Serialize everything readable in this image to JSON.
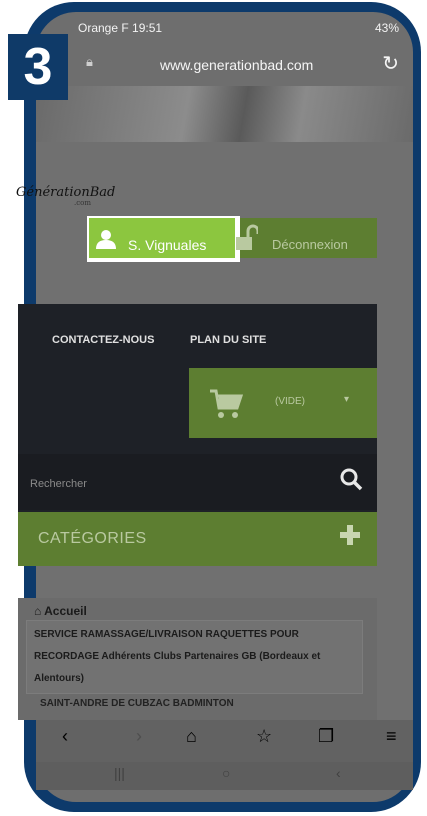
{
  "step_badge": "3",
  "status_bar": {
    "carrier_time": "Orange F  19:51",
    "right": "43%"
  },
  "url_bar": {
    "url": "www.generationbad.com"
  },
  "logo": {
    "name": "GénérationBad",
    "suffix": ".com"
  },
  "account": {
    "username": "S. Vignuales",
    "logout_label": "Déconnexion"
  },
  "nav": {
    "contact": "CONTACTEZ-NOUS",
    "sitemap": "PLAN DU SITE"
  },
  "cart": {
    "label": "(VIDE)"
  },
  "search": {
    "placeholder": "Rechercher"
  },
  "categories": {
    "label": "CATÉGORIES"
  },
  "breadcrumb": {
    "home": "Accueil",
    "item": "SERVICE RAMASSAGE/LIVRAISON RAQUETTES POUR RECORDAGE Adhérents Clubs Partenaires GB (Bordeaux et Alentours)",
    "next": "SAINT-ANDRE DE CUBZAC BADMINTON"
  },
  "colors": {
    "accent_green": "#8cc63f",
    "badge_blue": "#0f3a68",
    "frame_blue": "#0d3a6b"
  }
}
